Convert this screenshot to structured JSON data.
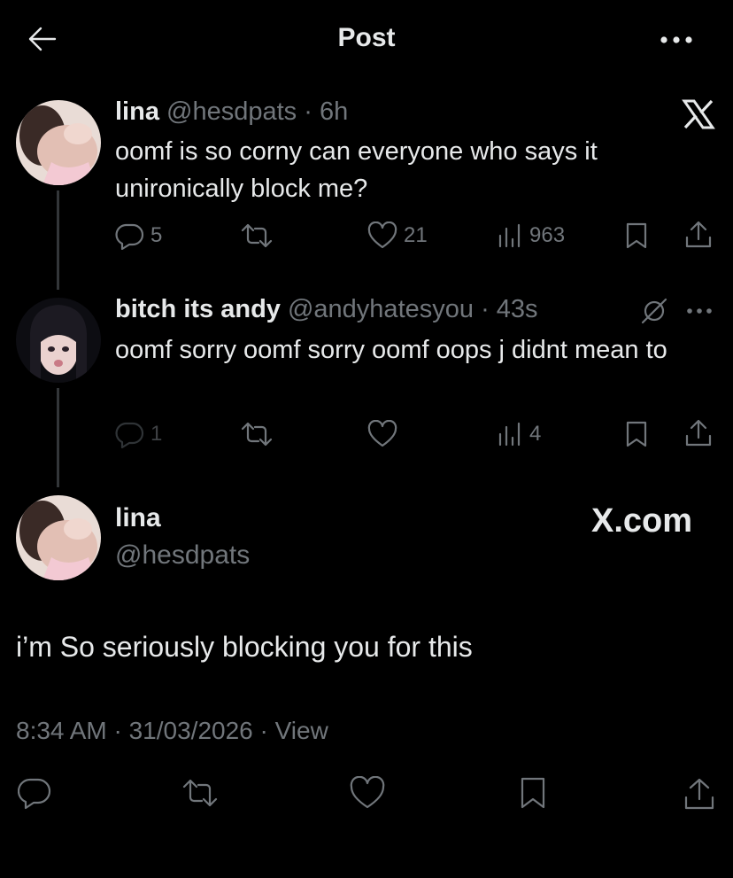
{
  "header": {
    "title": "Post",
    "back_icon": "arrow-left-icon",
    "more_icon": "more-horizontal-icon"
  },
  "thread": [
    {
      "name": "lina",
      "handle": "@hesdpats",
      "time": "· 6h",
      "text": "oomf is so corny can everyone who says it unironically block me?",
      "replies": "5",
      "retweets": "",
      "likes": "21",
      "views": "963",
      "badge_icon": "x-logo-icon"
    },
    {
      "name": "bitch its andy",
      "handle": "@andyhatesyou",
      "time": "· 43s",
      "text": "oomf sorry oomf sorry oomf oops j didnt mean to",
      "replies": "1",
      "retweets": "",
      "likes": "",
      "views": "4",
      "badge_icon": "grok-icon"
    }
  ],
  "main_post": {
    "name": "lina",
    "handle": "@hesdpats",
    "brand": "X.com",
    "text": "i’m So seriously blocking you for this",
    "meta": "8:34 AM · 31/03/2026 · View"
  },
  "colors": {
    "background": "#000000",
    "text": "#e7e9ea",
    "muted": "#71767b",
    "line": "#333639"
  }
}
